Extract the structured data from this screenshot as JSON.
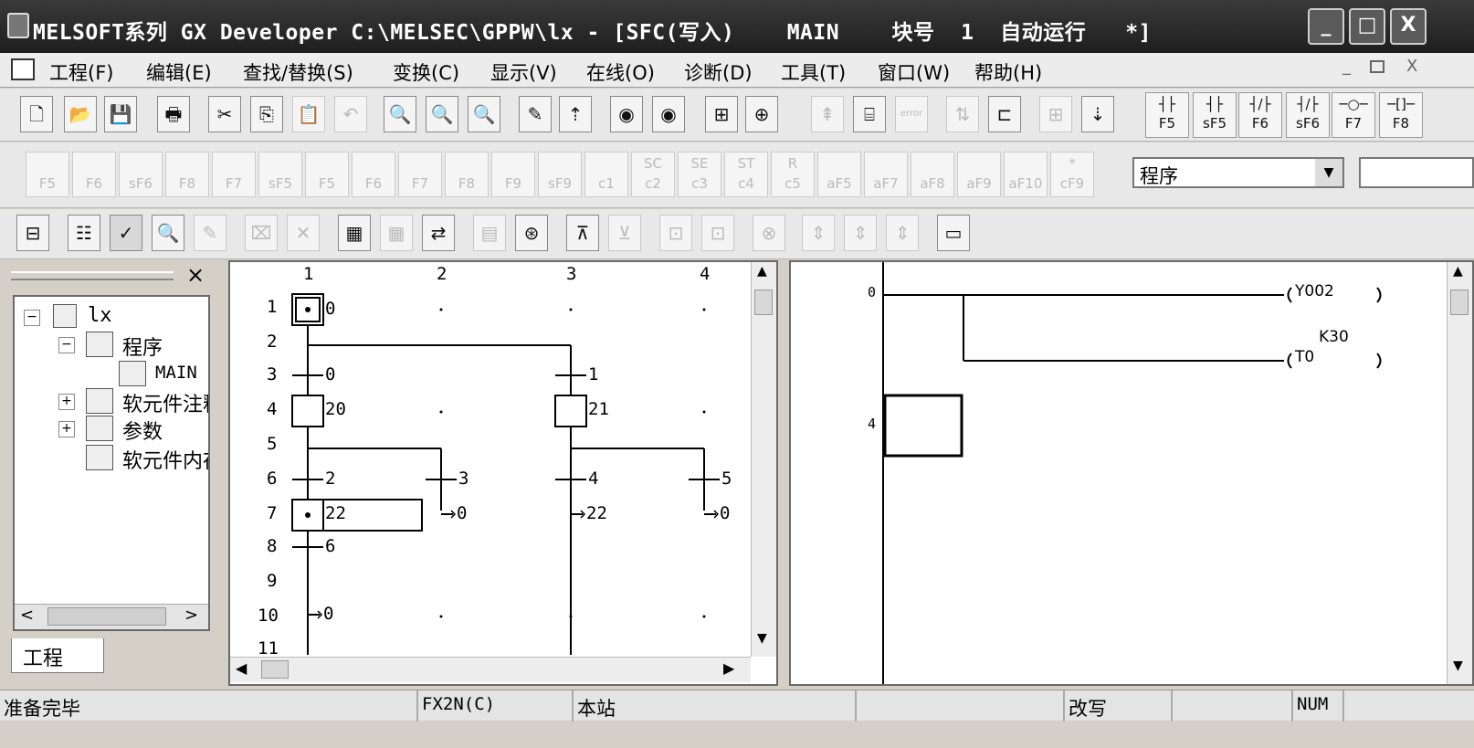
{
  "window": {
    "title": "MELSOFT系列 GX Developer C:\\MELSEC\\GPPW\\lx - [SFC(写入)    MAIN    块号  1  自动运行   *]",
    "minimize": "_",
    "maximize": "□",
    "close": "X"
  },
  "menu": {
    "items": [
      "工程(F)",
      "编辑(E)",
      "查找/替换(S)",
      "变换(C)",
      "显示(V)",
      "在线(O)",
      "诊断(D)",
      "工具(T)",
      "窗口(W)",
      "帮助(H)"
    ],
    "mdi_min": "_",
    "mdi_restore": "ð",
    "mdi_close": "X"
  },
  "toolbar1": {
    "sfc_keys": [
      {
        "icon": "┤├",
        "label": "F5"
      },
      {
        "icon": "┤├",
        "label": "sF5"
      },
      {
        "icon": "┤/├",
        "label": "F6"
      },
      {
        "icon": "┤/├",
        "label": "sF6"
      },
      {
        "icon": "─○─",
        "label": "F7"
      },
      {
        "icon": "─[]─",
        "label": "F8"
      }
    ]
  },
  "toolbar2": {
    "keys": [
      "F5",
      "F6",
      "sF6",
      "F8",
      "F7",
      "sF5",
      "F5",
      "F6",
      "F7",
      "F8",
      "F9",
      "sF9",
      "c1",
      "c2",
      "c3",
      "c4",
      "c5",
      "aF5",
      "aF7",
      "aF8",
      "aF9",
      "aF10",
      "cF9"
    ],
    "key_marks": [
      "",
      "",
      "",
      "",
      "",
      "",
      "",
      "",
      "",
      "",
      "",
      "",
      "",
      "SC",
      "SE",
      "ST",
      "R",
      "",
      "",
      "",
      "",
      "",
      "*"
    ],
    "program_select": "程序"
  },
  "tree": {
    "close": "×",
    "root": "lx",
    "items": [
      {
        "label": "程序",
        "expander": "−"
      },
      {
        "label": "MAIN",
        "expander": ""
      },
      {
        "label": "软元件注释",
        "expander": "+"
      },
      {
        "label": "参数",
        "expander": "+"
      },
      {
        "label": "软元件内存",
        "expander": ""
      }
    ],
    "tab": "工程",
    "scroll_left": "<",
    "scroll_right": ">"
  },
  "sfc": {
    "columns": [
      "1",
      "2",
      "3",
      "4"
    ],
    "rows": [
      "1",
      "2",
      "3",
      "4",
      "5",
      "6",
      "7",
      "8",
      "9",
      "10",
      "11"
    ],
    "labels": {
      "step0": "0",
      "t0": "0",
      "t1": "1",
      "step20": "20",
      "step21": "21",
      "t2": "2",
      "t3": "3",
      "t4": "4",
      "t5": "5",
      "j_a": "0",
      "step22": "22",
      "j_b": "22",
      "j_c": "0",
      "t6": "6",
      "j_d": "0"
    }
  },
  "ladder": {
    "step_a": "0",
    "step_b": "4",
    "coil1": "Y002",
    "coil2": "T0",
    "k_value": "K30"
  },
  "status": {
    "ready": "准备完毕",
    "plc": "FX2N(C)",
    "station": "本站",
    "mode": "改写",
    "num": "NUM"
  },
  "colors": {
    "titlebar": "#2a2a2a",
    "background": "#d4d0c8",
    "panel": "#ffffff"
  }
}
